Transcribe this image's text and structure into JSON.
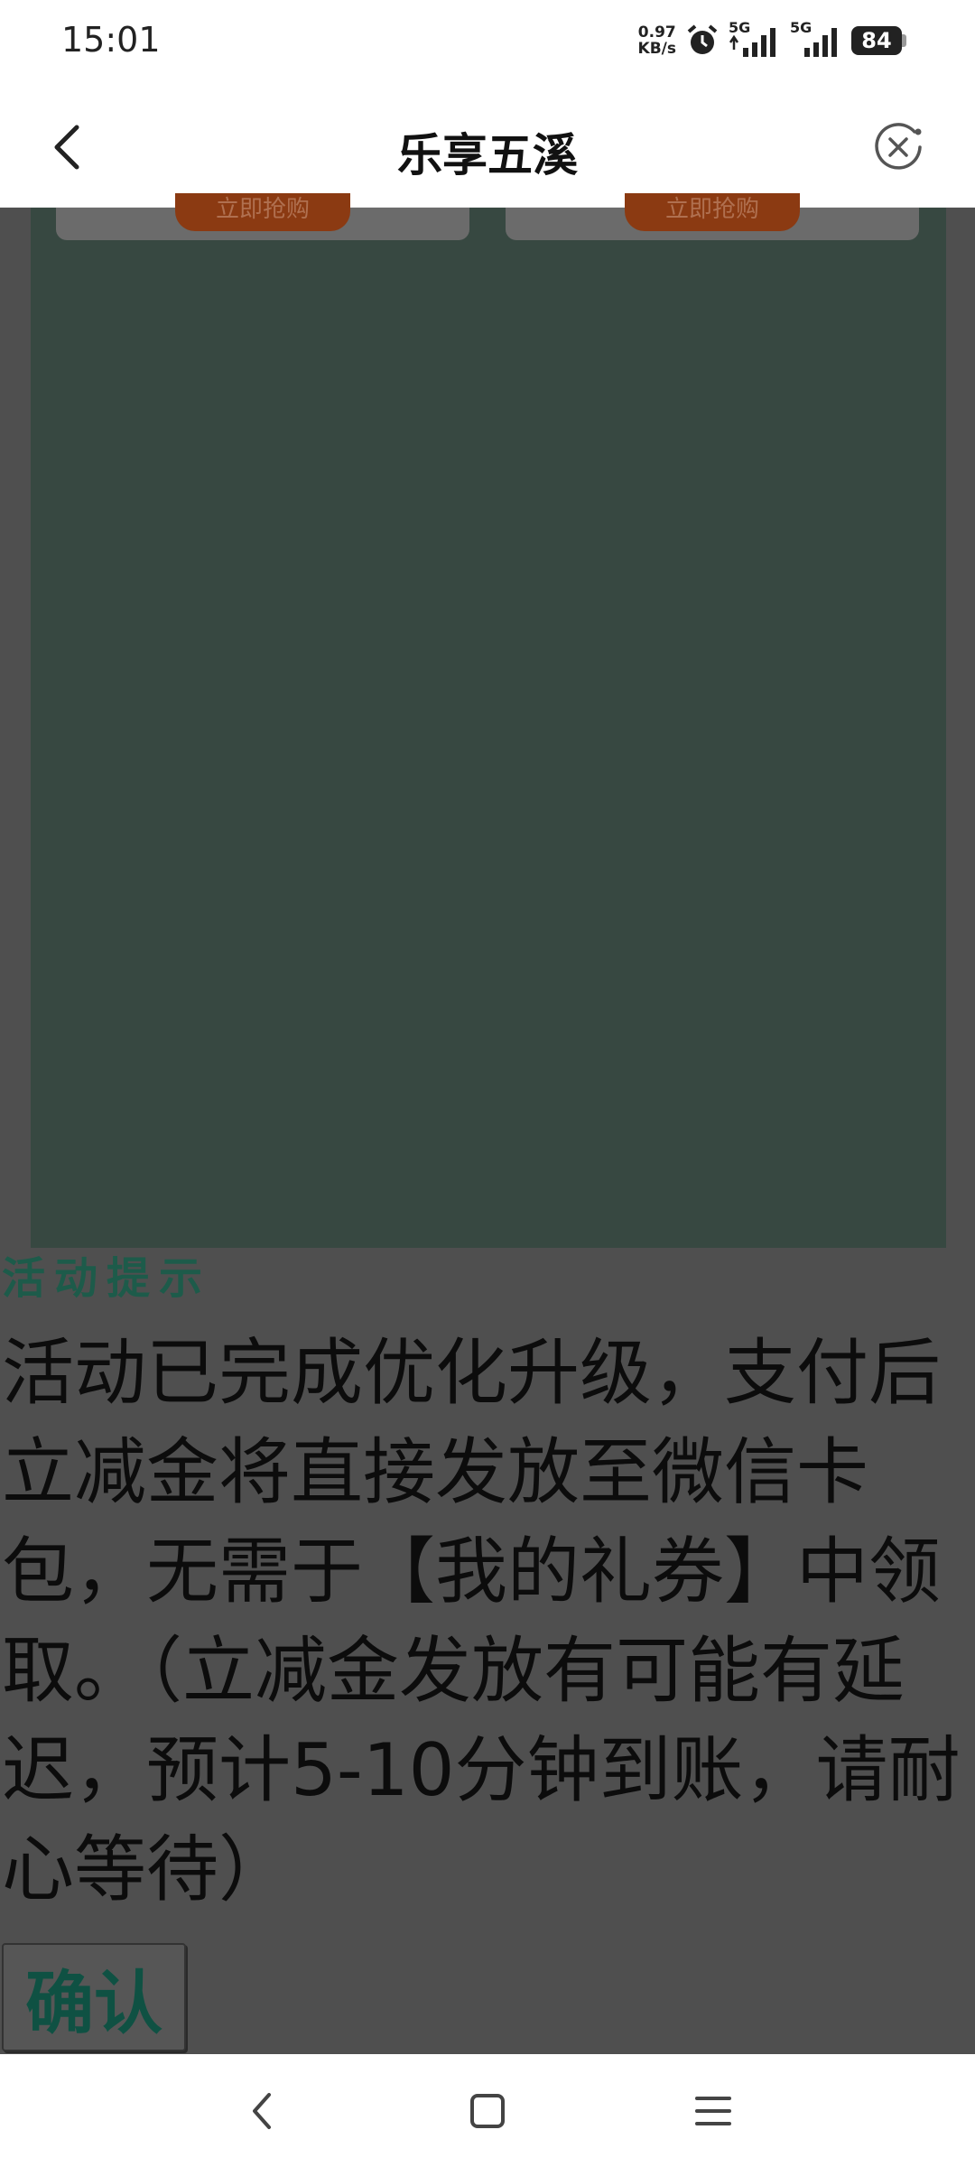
{
  "status_bar": {
    "time": "15:01",
    "net_speed_value": "0.97",
    "net_speed_unit": "KB/s",
    "network_1": "5G",
    "network_2": "5G",
    "battery": "84",
    "icons": [
      "alarm-icon",
      "signal-icon",
      "signal-icon",
      "battery-icon"
    ]
  },
  "title_bar": {
    "title": "乐享五溪",
    "back_icon": "chevron-left-icon",
    "close_icon": "close-circle-icon"
  },
  "product_cards": [
    {
      "button_label": "立即抢购"
    },
    {
      "button_label": "立即抢购"
    }
  ],
  "dialog": {
    "title": "活动提示",
    "message": "活动已完成优化升级，支付后立减金将直接发放至微信卡包，无需于【我的礼券】中领取。（立减金发放有可能有延迟，预计5-10分钟到账，请耐心等待）",
    "confirm_label": "确认"
  },
  "nav_bar": {
    "icons": [
      "back-nav-icon",
      "home-nav-icon",
      "menu-nav-icon"
    ]
  }
}
